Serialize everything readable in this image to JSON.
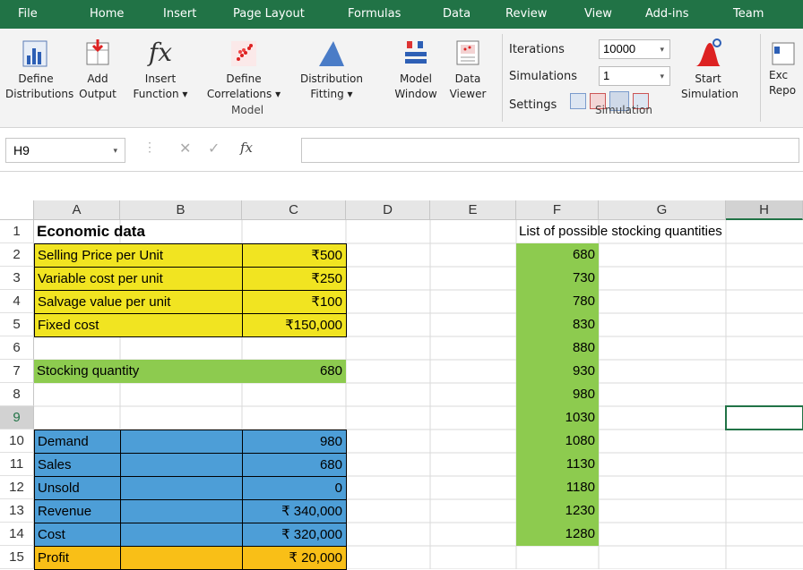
{
  "tabs": [
    "File",
    "Home",
    "Insert",
    "Page Layout",
    "Formulas",
    "Data",
    "Review",
    "View",
    "Add-ins",
    "Team"
  ],
  "ribbon": {
    "buttons": [
      {
        "line1": "Define",
        "line2": "Distributions"
      },
      {
        "line1": "Add",
        "line2": "Output"
      },
      {
        "line1": "Insert",
        "line2": "Function ▾"
      },
      {
        "line1": "Define",
        "line2": "Correlations ▾"
      },
      {
        "line1": "Distribution",
        "line2": "Fitting ▾"
      },
      {
        "line1": "Model",
        "line2": "Window"
      },
      {
        "line1": "Data",
        "line2": "Viewer"
      }
    ],
    "model_group": "Model",
    "iterations_label": "Iterations",
    "iterations_value": "10000",
    "simulations_label": "Simulations",
    "simulations_value": "1",
    "settings_label": "Settings",
    "start_line1": "Start",
    "start_line2": "Simulation",
    "simulation_group": "Simulation",
    "excel_line1": "Exc",
    "excel_line2": "Repo"
  },
  "formula_bar": {
    "name_box": "H9",
    "fx": "fx",
    "value": ""
  },
  "columns": [
    "A",
    "B",
    "C",
    "D",
    "E",
    "F",
    "G",
    "H"
  ],
  "rows": [
    "1",
    "2",
    "3",
    "4",
    "5",
    "6",
    "7",
    "8",
    "9",
    "10",
    "11",
    "12",
    "13",
    "14",
    "15"
  ],
  "sheet": {
    "title": "Economic data",
    "labels": [
      "Selling Price per Unit",
      "Variable cost per unit",
      "Salvage value per unit",
      "Fixed cost"
    ],
    "values": [
      "₹500",
      "₹250",
      "₹100",
      "₹150,000"
    ],
    "stocking_label": "Stocking quantity",
    "stocking_value": "680",
    "results_labels": [
      "Demand",
      "Sales",
      "Unsold",
      "Revenue",
      "Cost",
      "Profit"
    ],
    "results_values": [
      "980",
      "680",
      "0",
      "₹ 340,000",
      "₹ 320,000",
      "₹ 20,000"
    ],
    "list_title": "List of possible stocking quantities",
    "list_values": [
      "680",
      "730",
      "780",
      "830",
      "880",
      "930",
      "980",
      "1030",
      "1080",
      "1130",
      "1180",
      "1230",
      "1280"
    ]
  }
}
